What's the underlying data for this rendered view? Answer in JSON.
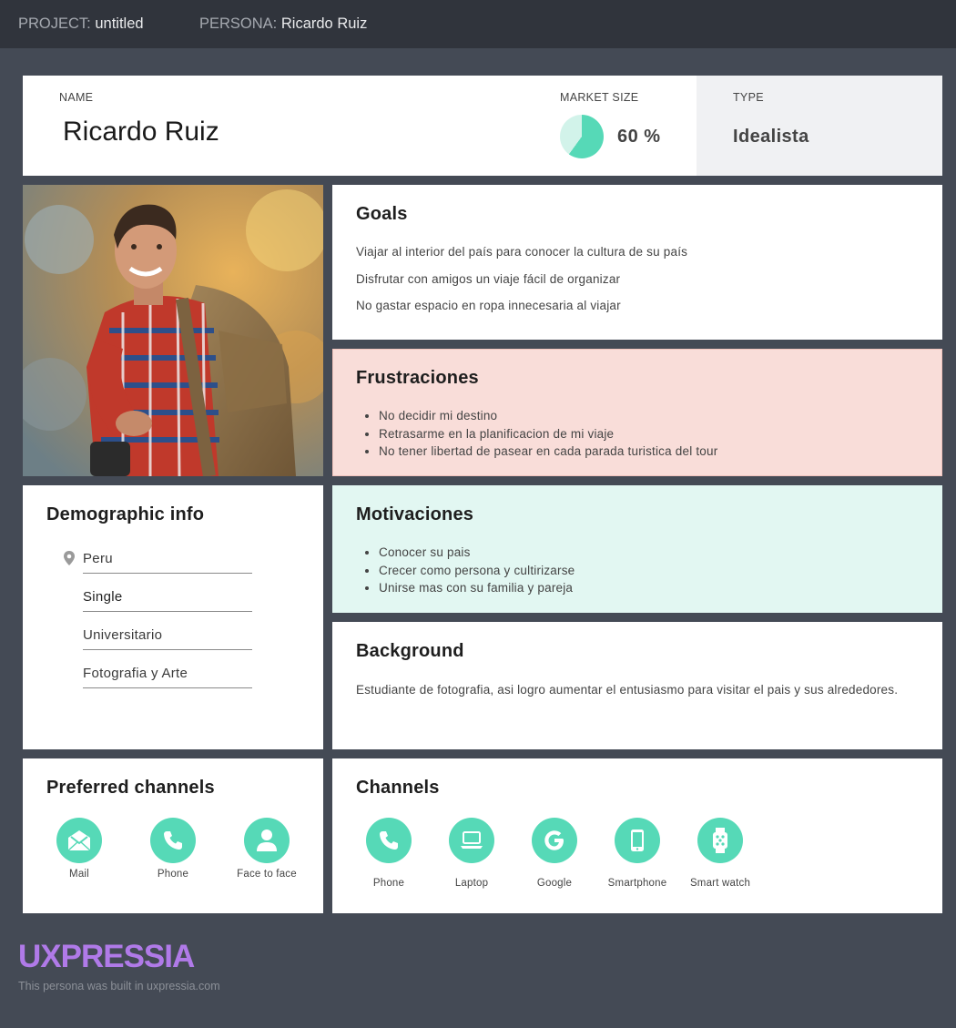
{
  "topbar": {
    "project_key": "PROJECT:",
    "project_value": "untitled",
    "persona_key": "PERSONA:",
    "persona_value": "Ricardo Ruiz"
  },
  "header": {
    "name_label": "NAME",
    "name": "Ricardo Ruiz",
    "market_label": "MARKET SIZE",
    "market_value": "60 %",
    "market_fraction": 0.6,
    "type_label": "TYPE",
    "type_value": "Idealista"
  },
  "goals": {
    "title": "Goals",
    "items": [
      "Viajar al interior del país para conocer la cultura de su país",
      "Disfrutar con amigos un viaje fácil de organizar",
      "No gastar espacio en ropa innecesaria al viajar"
    ]
  },
  "frustrations": {
    "title": "Frustraciones",
    "items": [
      "No decidir mi destino",
      "Retrasarme en la planificacion de mi viaje",
      "No tener libertad de pasear en cada parada turistica del tour"
    ]
  },
  "demographic": {
    "title": "Demographic info",
    "items": [
      "Peru",
      "Single",
      "Universitario",
      "Fotografia y Arte"
    ]
  },
  "motivations": {
    "title": "Motivaciones",
    "items": [
      "Conocer su pais",
      "Crecer como persona y cultirizarse",
      "Unirse mas con su familia y pareja"
    ]
  },
  "background": {
    "title": "Background",
    "text": "Estudiante de fotografia, asi logro aumentar el entusiasmo para visitar el pais y sus alrededores."
  },
  "preferred_channels": {
    "title": "Preferred channels",
    "items": [
      {
        "label": "Mail",
        "icon": "mail-icon"
      },
      {
        "label": "Phone",
        "icon": "phone-icon"
      },
      {
        "label": "Face to face",
        "icon": "person-icon"
      }
    ]
  },
  "channels": {
    "title": "Channels",
    "items": [
      {
        "label": "Phone",
        "icon": "phone-icon"
      },
      {
        "label": "Laptop",
        "icon": "laptop-icon"
      },
      {
        "label": "Google",
        "icon": "google-icon"
      },
      {
        "label": "Smartphone",
        "icon": "smartphone-icon"
      },
      {
        "label": "Smart watch",
        "icon": "smartwatch-icon"
      }
    ]
  },
  "colors": {
    "accent": "#56d9b7",
    "frustration_bg": "#f9ddd9",
    "motivation_bg": "#e2f7f2",
    "brand": "#b07ae8"
  },
  "footer": {
    "logo": "UXPRESSIA",
    "note": "This persona was built in uxpressia.com"
  }
}
